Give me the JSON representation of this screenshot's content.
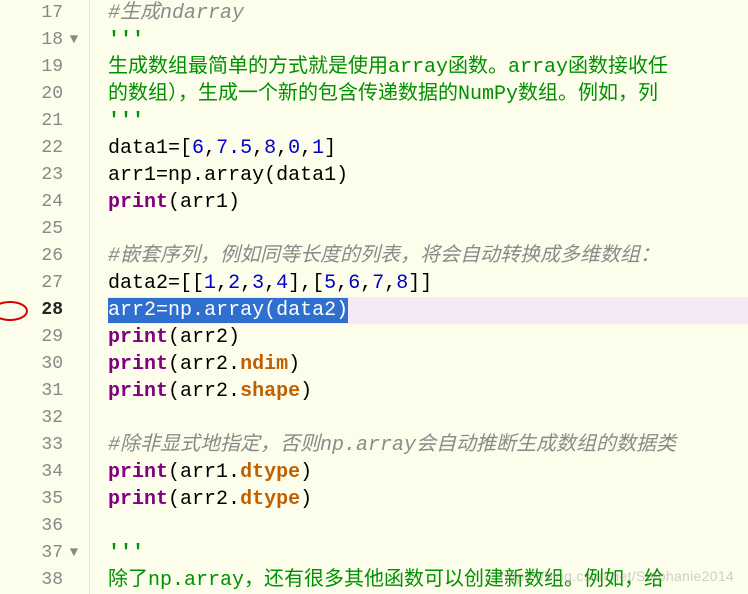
{
  "editor": {
    "first_line_number": 17,
    "current_line": 28,
    "fold_lines": [
      18,
      37
    ],
    "lines": [
      {
        "tokens": [
          {
            "t": "#生成ndarray",
            "cls": "c-comment"
          }
        ]
      },
      {
        "tokens": [
          {
            "t": "'''",
            "cls": "c-docquote"
          }
        ]
      },
      {
        "tokens": [
          {
            "t": "生成数组最简单的方式就是使用array函数。array函数接收任",
            "cls": "c-docstring"
          }
        ]
      },
      {
        "tokens": [
          {
            "t": "的数组），生成一个新的包含传递数据的NumPy数组。例如，列",
            "cls": "c-docstring"
          }
        ]
      },
      {
        "tokens": [
          {
            "t": "'''",
            "cls": "c-docquote"
          }
        ]
      },
      {
        "tokens": [
          {
            "t": "data1",
            "cls": "c-ident"
          },
          {
            "t": "=[",
            "cls": "c-op"
          },
          {
            "t": "6",
            "cls": "c-num"
          },
          {
            "t": ",",
            "cls": "c-op"
          },
          {
            "t": "7.5",
            "cls": "c-num"
          },
          {
            "t": ",",
            "cls": "c-op"
          },
          {
            "t": "8",
            "cls": "c-num"
          },
          {
            "t": ",",
            "cls": "c-op"
          },
          {
            "t": "0",
            "cls": "c-num"
          },
          {
            "t": ",",
            "cls": "c-op"
          },
          {
            "t": "1",
            "cls": "c-num"
          },
          {
            "t": "]",
            "cls": "c-op"
          }
        ]
      },
      {
        "tokens": [
          {
            "t": "arr1",
            "cls": "c-ident"
          },
          {
            "t": "=",
            "cls": "c-op"
          },
          {
            "t": "np",
            "cls": "c-ident"
          },
          {
            "t": ".",
            "cls": "c-op"
          },
          {
            "t": "array",
            "cls": "c-func"
          },
          {
            "t": "(",
            "cls": "c-op"
          },
          {
            "t": "data1",
            "cls": "c-ident"
          },
          {
            "t": ")",
            "cls": "c-op"
          }
        ]
      },
      {
        "tokens": [
          {
            "t": "print",
            "cls": "c-builtin"
          },
          {
            "t": "(",
            "cls": "c-op"
          },
          {
            "t": "arr1",
            "cls": "c-ident"
          },
          {
            "t": ")",
            "cls": "c-op"
          }
        ]
      },
      {
        "tokens": []
      },
      {
        "tokens": [
          {
            "t": "#嵌套序列，例如同等长度的列表，将会自动转换成多维数组：",
            "cls": "c-comment"
          }
        ]
      },
      {
        "tokens": [
          {
            "t": "data2",
            "cls": "c-ident"
          },
          {
            "t": "=[[",
            "cls": "c-op"
          },
          {
            "t": "1",
            "cls": "c-num"
          },
          {
            "t": ",",
            "cls": "c-op"
          },
          {
            "t": "2",
            "cls": "c-num"
          },
          {
            "t": ",",
            "cls": "c-op"
          },
          {
            "t": "3",
            "cls": "c-num"
          },
          {
            "t": ",",
            "cls": "c-op"
          },
          {
            "t": "4",
            "cls": "c-num"
          },
          {
            "t": "],[",
            "cls": "c-op"
          },
          {
            "t": "5",
            "cls": "c-num"
          },
          {
            "t": ",",
            "cls": "c-op"
          },
          {
            "t": "6",
            "cls": "c-num"
          },
          {
            "t": ",",
            "cls": "c-op"
          },
          {
            "t": "7",
            "cls": "c-num"
          },
          {
            "t": ",",
            "cls": "c-op"
          },
          {
            "t": "8",
            "cls": "c-num"
          },
          {
            "t": "]]",
            "cls": "c-op"
          }
        ]
      },
      {
        "selected": true,
        "tokens": [
          {
            "t": "arr2",
            "cls": "c-ident"
          },
          {
            "t": "=",
            "cls": "c-op"
          },
          {
            "t": "np",
            "cls": "c-ident"
          },
          {
            "t": ".",
            "cls": "c-op"
          },
          {
            "t": "array",
            "cls": "c-func"
          },
          {
            "t": "(",
            "cls": "c-op"
          },
          {
            "t": "data2",
            "cls": "c-ident"
          },
          {
            "t": ")",
            "cls": "c-op"
          }
        ]
      },
      {
        "tokens": [
          {
            "t": "print",
            "cls": "c-builtin"
          },
          {
            "t": "(",
            "cls": "c-op"
          },
          {
            "t": "arr2",
            "cls": "c-ident"
          },
          {
            "t": ")",
            "cls": "c-op"
          }
        ]
      },
      {
        "tokens": [
          {
            "t": "print",
            "cls": "c-builtin"
          },
          {
            "t": "(",
            "cls": "c-op"
          },
          {
            "t": "arr2",
            "cls": "c-ident"
          },
          {
            "t": ".",
            "cls": "c-op"
          },
          {
            "t": "ndim",
            "cls": "c-orange"
          },
          {
            "t": ")",
            "cls": "c-op"
          }
        ]
      },
      {
        "tokens": [
          {
            "t": "print",
            "cls": "c-builtin"
          },
          {
            "t": "(",
            "cls": "c-op"
          },
          {
            "t": "arr2",
            "cls": "c-ident"
          },
          {
            "t": ".",
            "cls": "c-op"
          },
          {
            "t": "shape",
            "cls": "c-orange"
          },
          {
            "t": ")",
            "cls": "c-op"
          }
        ]
      },
      {
        "tokens": []
      },
      {
        "tokens": [
          {
            "t": "#除非显式地指定，否则np.array会自动推断生成数组的数据类",
            "cls": "c-comment"
          }
        ]
      },
      {
        "tokens": [
          {
            "t": "print",
            "cls": "c-builtin"
          },
          {
            "t": "(",
            "cls": "c-op"
          },
          {
            "t": "arr1",
            "cls": "c-ident"
          },
          {
            "t": ".",
            "cls": "c-op"
          },
          {
            "t": "dtype",
            "cls": "c-orange"
          },
          {
            "t": ")",
            "cls": "c-op"
          }
        ]
      },
      {
        "tokens": [
          {
            "t": "print",
            "cls": "c-builtin"
          },
          {
            "t": "(",
            "cls": "c-op"
          },
          {
            "t": "arr2",
            "cls": "c-ident"
          },
          {
            "t": ".",
            "cls": "c-op"
          },
          {
            "t": "dtype",
            "cls": "c-orange"
          },
          {
            "t": ")",
            "cls": "c-op"
          }
        ]
      },
      {
        "tokens": []
      },
      {
        "tokens": [
          {
            "t": "'''",
            "cls": "c-docquote"
          }
        ]
      },
      {
        "tokens": [
          {
            "t": "除了np.array，还有很多其他函数可以创建新数组。例如，给",
            "cls": "c-docstring"
          }
        ]
      }
    ]
  },
  "watermark": "https://blog.csdn.net/Stephanie2014"
}
